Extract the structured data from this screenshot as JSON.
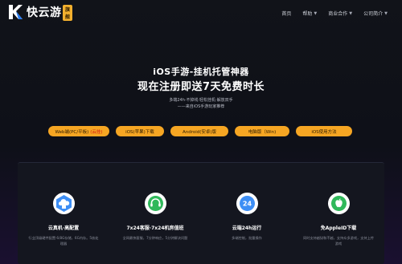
{
  "header": {
    "logo_text": "快云游",
    "logo_badge": "旗舰",
    "nav": [
      {
        "label": "首页",
        "has_caret": false
      },
      {
        "label": "帮助",
        "has_caret": true
      },
      {
        "label": "商业合作",
        "has_caret": true
      },
      {
        "label": "公司简介",
        "has_caret": true
      }
    ]
  },
  "hero": {
    "title_line1": "iOS手游-挂机托管神器",
    "title_line2": "现在注册即送7天免费时长",
    "subtitle_line1": "多端24h·不掉线·轻松挂机·解放双手",
    "subtitle_line2": "——来自iOS手游玩家推荐"
  },
  "download_buttons": [
    {
      "label": "Web端(PC/平板)",
      "extra": "(云挂)"
    },
    {
      "label": "iOS(苹果)下载",
      "extra": ""
    },
    {
      "label": "Android(安卓)版",
      "extra": ""
    },
    {
      "label": "电脑版（Win)",
      "extra": ""
    },
    {
      "label": "iOS使用方法",
      "extra": ""
    }
  ],
  "features": [
    {
      "icon": "cloud-phone-icon",
      "title": "云真机·高配置",
      "desc": "行业顶级硬件配置·6/8G存储，6G内存。5核处理器"
    },
    {
      "icon": "headset-support-icon",
      "title": "7x24客服·7x24机房值班",
      "desc": "全网最快客服，7分钟响应，5分钟解决问题"
    },
    {
      "icon": "24h-icon",
      "title": "云端24h运行",
      "desc": "多端控制，批量操作"
    },
    {
      "icon": "apple-icon",
      "title": "免AppleID下载",
      "desc": "同时支持越狱和不越，支持众多游戏，支持上传游戏"
    }
  ],
  "colors": {
    "accent": "#f6a623",
    "badge": "#f3b02e",
    "icon_blue": "#3d8ef5",
    "icon_green": "#2fb85a"
  }
}
